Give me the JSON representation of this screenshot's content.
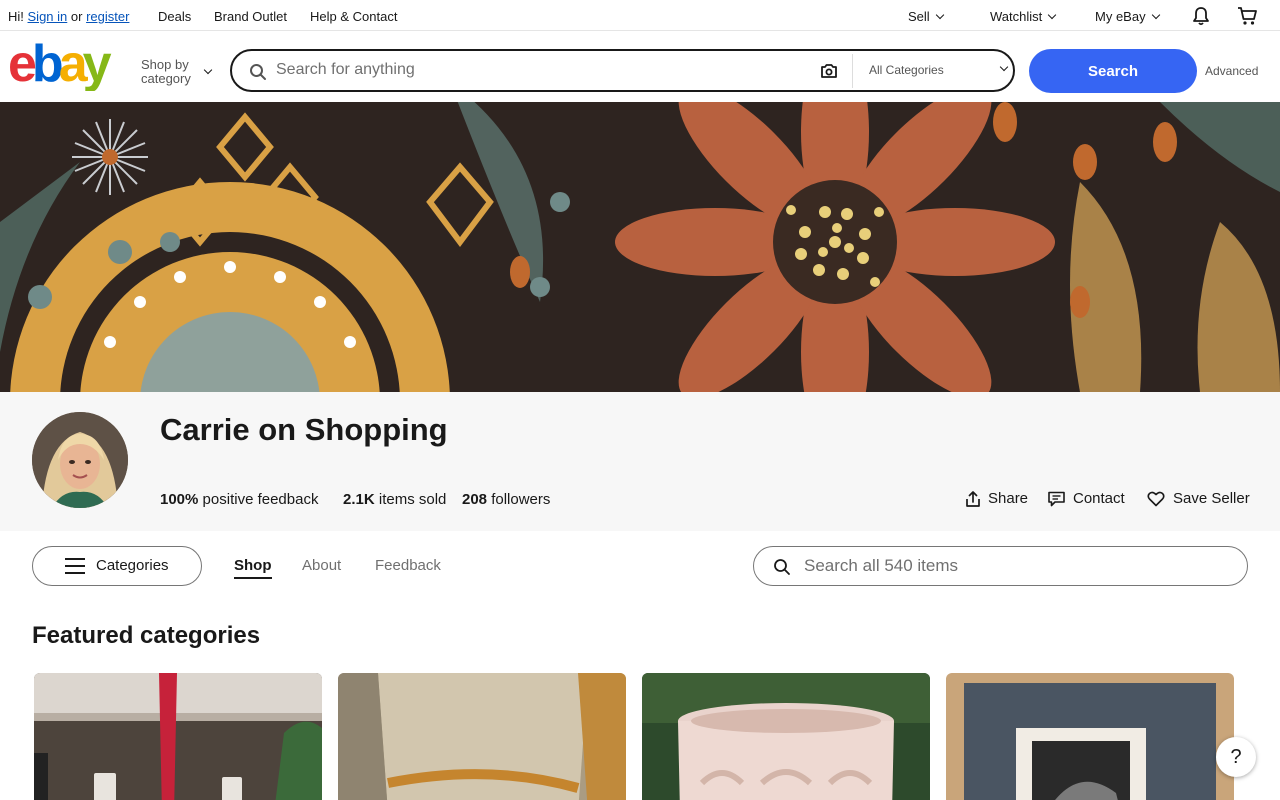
{
  "topbar": {
    "greeting": "Hi!",
    "sign_in": "Sign in",
    "or": "or",
    "register": "register",
    "deals": "Deals",
    "brand_outlet": "Brand Outlet",
    "help_contact": "Help & Contact",
    "sell": "Sell",
    "watchlist": "Watchlist",
    "my_ebay": "My eBay",
    "icons": [
      "bell-icon",
      "cart-icon"
    ]
  },
  "header": {
    "shop_by_line1": "Shop by",
    "shop_by_line2": "category",
    "search_placeholder": "Search for anything",
    "category_select": "All Categories",
    "search_button": "Search",
    "advanced": "Advanced",
    "logo_colors": [
      "#e53238",
      "#0064d2",
      "#f5af02",
      "#86b817"
    ]
  },
  "store": {
    "name": "Carrie on Shopping",
    "feedback_value": "100%",
    "feedback_label": "positive feedback",
    "sold_value": "2.1K",
    "sold_label": "items sold",
    "followers_value": "208",
    "followers_label": "followers",
    "share": "Share",
    "contact": "Contact",
    "save_seller": "Save Seller"
  },
  "nav": {
    "categories": "Categories",
    "tabs": [
      {
        "label": "Shop",
        "active": true
      },
      {
        "label": "About",
        "active": false
      },
      {
        "label": "Feedback",
        "active": false
      }
    ],
    "store_search_placeholder": "Search all 540 items"
  },
  "featured": {
    "title": "Featured categories"
  },
  "help": {
    "label": "?"
  },
  "colors": {
    "accent": "#3665f3",
    "link": "#0654ba",
    "text": "#191919"
  }
}
